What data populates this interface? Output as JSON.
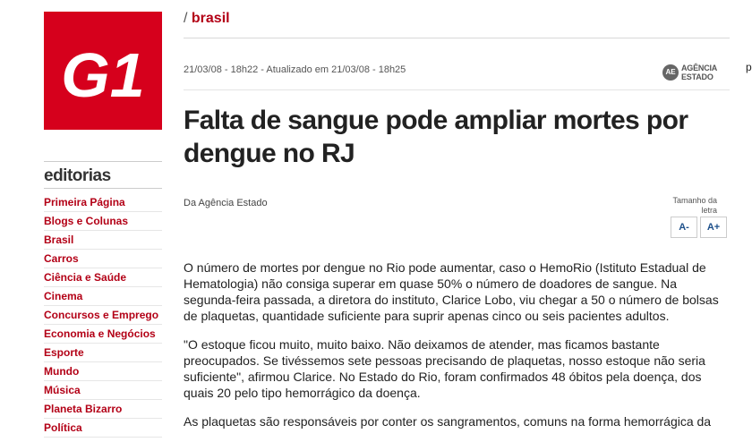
{
  "logo": {
    "text": "G1"
  },
  "sidebar": {
    "title": "editorias",
    "items": [
      "Primeira Página",
      "Blogs e Colunas",
      "Brasil",
      "Carros",
      "Ciência e Saúde",
      "Cinema",
      "Concursos e Emprego",
      "Economia e Negócios",
      "Esporte",
      "Mundo",
      "Música",
      "Planeta Bizarro",
      "Política"
    ]
  },
  "header": {
    "slash": "/",
    "section": "brasil",
    "date": "21/03/08 - 18h22 - Atualizado em 21/03/08 - 18h25",
    "agency_badge": "AE",
    "agency_line1": "AGÊNCIA",
    "agency_line2": "ESTADO"
  },
  "article": {
    "title": "Falta de sangue pode ampliar mortes por dengue no RJ",
    "byline": "Da Agência Estado",
    "font_size_label": "Tamanho da letra",
    "font_decrease": "A-",
    "font_increase": "A+",
    "paragraphs": [
      "O número de mortes por dengue no Rio pode aumentar, caso o HemoRio (Istituto Estadual de Hematologia) não consiga superar em quase 50% o número de doadores de sangue. Na segunda-feira passada, a diretora do instituto, Clarice Lobo, viu chegar a 50 o número de bolsas de plaquetas, quantidade suficiente para suprir apenas cinco ou seis pacientes adultos.",
      "\"O estoque ficou muito, muito baixo. Não deixamos de atender, mas ficamos bastante preocupados. Se tivéssemos sete pessoas precisando de plaquetas, nosso estoque não seria suficiente\", afirmou Clarice. No Estado do Rio, foram confirmados 48 óbitos pela doença, dos quais 20 pelo tipo hemorrágico da doença.",
      "As plaquetas são responsáveis por conter os sangramentos, comuns na forma hemorrágica da"
    ]
  },
  "edge": {
    "mark": "p"
  },
  "colors": {
    "brand_red": "#d6001c",
    "link_red": "#b30016",
    "button_blue": "#1c4f8a"
  }
}
